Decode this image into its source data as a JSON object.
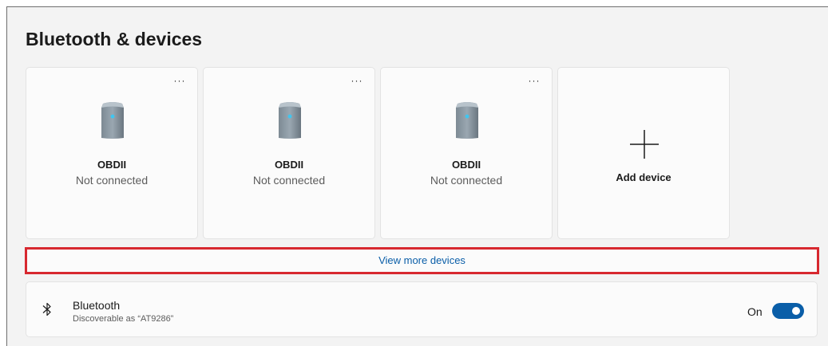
{
  "page": {
    "title": "Bluetooth & devices"
  },
  "devices": [
    {
      "name": "OBDII",
      "status": "Not connected",
      "more_label": "···",
      "icon": "device-tower-icon"
    },
    {
      "name": "OBDII",
      "status": "Not connected",
      "more_label": "···",
      "icon": "device-tower-icon"
    },
    {
      "name": "OBDII",
      "status": "Not connected",
      "more_label": "···",
      "icon": "device-tower-icon"
    }
  ],
  "add_device": {
    "label": "Add device",
    "icon": "plus-icon"
  },
  "view_more": {
    "label": "View more devices"
  },
  "bluetooth": {
    "title": "Bluetooth",
    "subtitle": "Discoverable as “AT9286”",
    "state_label": "On",
    "enabled": true,
    "icon": "bluetooth-icon"
  },
  "colors": {
    "accent": "#0a5ea8",
    "highlight_border": "#d7282f",
    "background": "#f3f3f3",
    "card": "#fbfbfb"
  }
}
